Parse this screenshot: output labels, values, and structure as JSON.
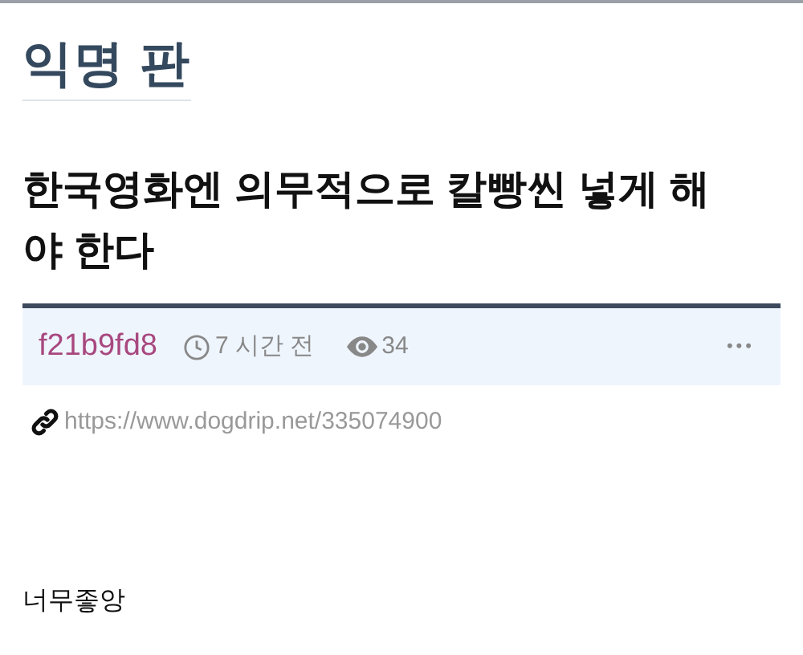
{
  "board": {
    "title": "익명 판"
  },
  "post": {
    "title": "한국영화엔 의무적으로 칼빵씬 넣게 해야 한다",
    "author": "f21b9fd8",
    "time": "7 시간 전",
    "views": "34",
    "more": "•••",
    "link": "https://www.dogdrip.net/335074900",
    "body": "너무좋앙"
  }
}
